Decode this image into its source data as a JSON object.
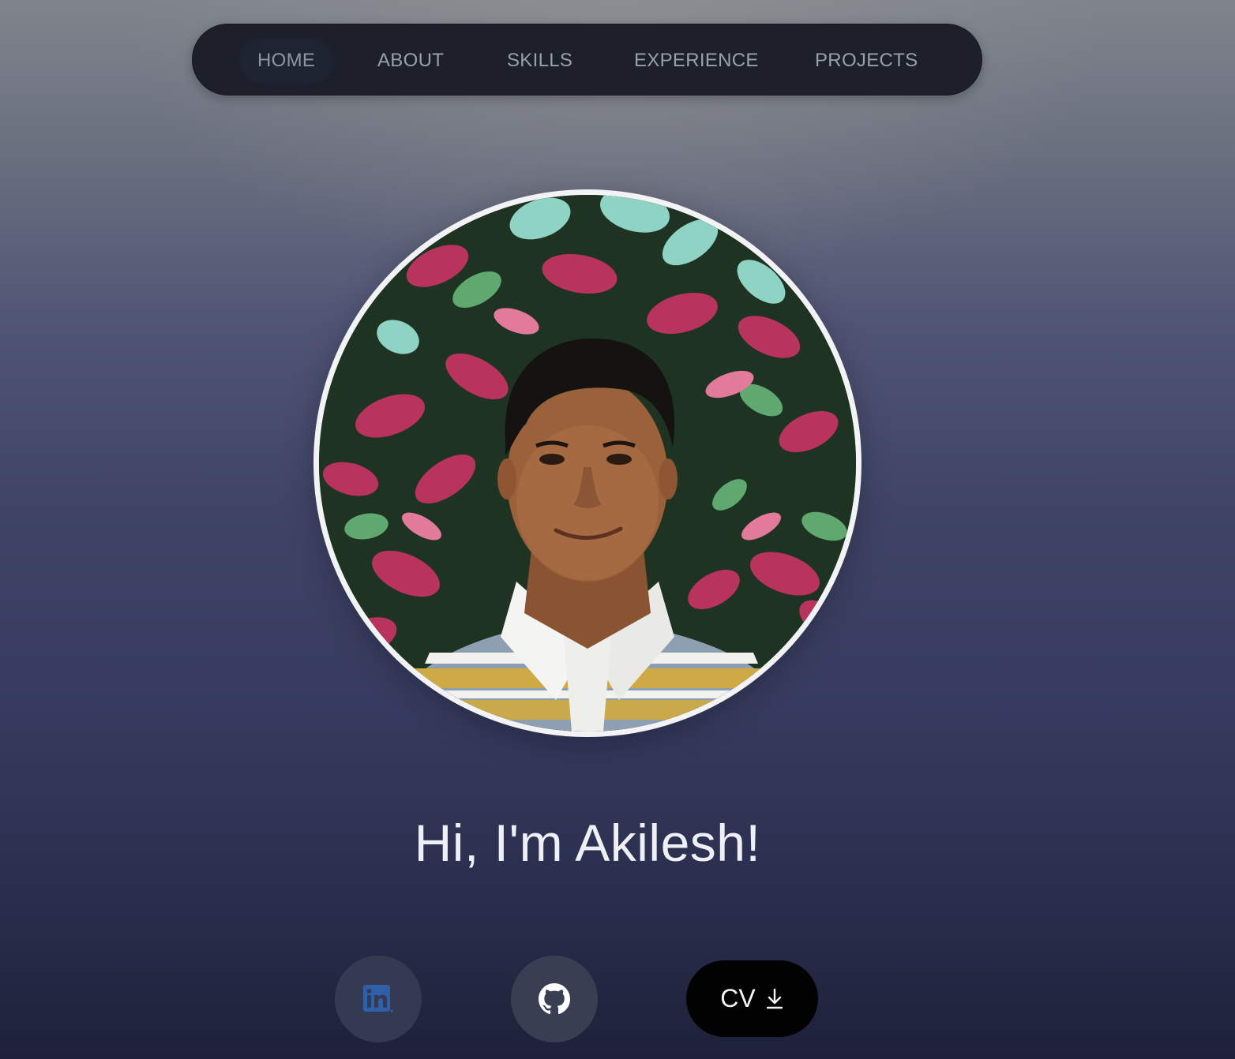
{
  "nav": {
    "items": [
      {
        "label": "HOME",
        "active": true
      },
      {
        "label": "ABOUT",
        "active": false
      },
      {
        "label": "SKILLS",
        "active": false
      },
      {
        "label": "EXPERIENCE",
        "active": false
      },
      {
        "label": "PROJECTS",
        "active": false
      }
    ]
  },
  "hero": {
    "headline": "Hi, I'm Akilesh!"
  },
  "actions": {
    "linkedin_icon": "linkedin-icon",
    "github_icon": "github-icon",
    "cv_label": "CV",
    "cv_icon": "download-icon"
  },
  "colors": {
    "linkedin_blue": "#2f5fa8",
    "cv_button_bg": "#020203",
    "nav_bg": "#1d202b"
  }
}
